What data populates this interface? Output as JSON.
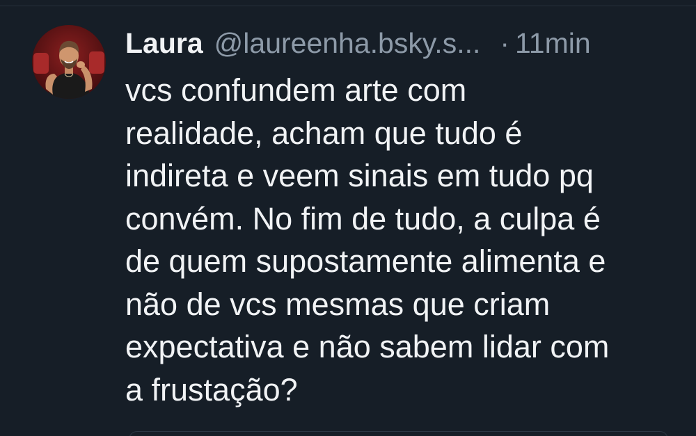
{
  "post": {
    "author": {
      "display_name": "Laura",
      "handle": "@laureenha.bsky.s...",
      "avatar": "avatar-photo"
    },
    "separator": "·",
    "timestamp": "11min",
    "text": "vcs confundem arte com\nrealidade, acham que tudo é\nindireta e veem sinais em tudo pq\nconvém. No fim de tudo, a culpa é\nde quem supostamente alimenta e\nnão de vcs mesmas que criam\nexpectativa e não sabem lidar com\na frustação?"
  },
  "colors": {
    "background": "#161e27",
    "primary_text": "#f1f3f5",
    "secondary_text": "#8d9aa8"
  }
}
